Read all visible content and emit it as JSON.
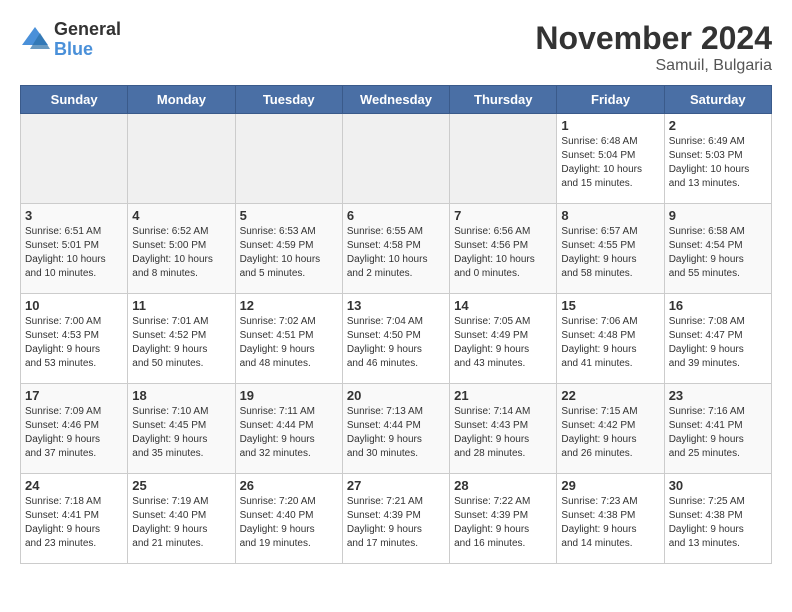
{
  "logo": {
    "general": "General",
    "blue": "Blue"
  },
  "header": {
    "title": "November 2024",
    "subtitle": "Samuil, Bulgaria"
  },
  "weekdays": [
    "Sunday",
    "Monday",
    "Tuesday",
    "Wednesday",
    "Thursday",
    "Friday",
    "Saturday"
  ],
  "weeks": [
    {
      "row_class": "week-row-1",
      "days": [
        {
          "num": "",
          "info": "",
          "empty": true
        },
        {
          "num": "",
          "info": "",
          "empty": true
        },
        {
          "num": "",
          "info": "",
          "empty": true
        },
        {
          "num": "",
          "info": "",
          "empty": true
        },
        {
          "num": "",
          "info": "",
          "empty": true
        },
        {
          "num": "1",
          "info": "Sunrise: 6:48 AM\nSunset: 5:04 PM\nDaylight: 10 hours\nand 15 minutes.",
          "empty": false
        },
        {
          "num": "2",
          "info": "Sunrise: 6:49 AM\nSunset: 5:03 PM\nDaylight: 10 hours\nand 13 minutes.",
          "empty": false
        }
      ]
    },
    {
      "row_class": "week-row-2",
      "days": [
        {
          "num": "3",
          "info": "Sunrise: 6:51 AM\nSunset: 5:01 PM\nDaylight: 10 hours\nand 10 minutes.",
          "empty": false
        },
        {
          "num": "4",
          "info": "Sunrise: 6:52 AM\nSunset: 5:00 PM\nDaylight: 10 hours\nand 8 minutes.",
          "empty": false
        },
        {
          "num": "5",
          "info": "Sunrise: 6:53 AM\nSunset: 4:59 PM\nDaylight: 10 hours\nand 5 minutes.",
          "empty": false
        },
        {
          "num": "6",
          "info": "Sunrise: 6:55 AM\nSunset: 4:58 PM\nDaylight: 10 hours\nand 2 minutes.",
          "empty": false
        },
        {
          "num": "7",
          "info": "Sunrise: 6:56 AM\nSunset: 4:56 PM\nDaylight: 10 hours\nand 0 minutes.",
          "empty": false
        },
        {
          "num": "8",
          "info": "Sunrise: 6:57 AM\nSunset: 4:55 PM\nDaylight: 9 hours\nand 58 minutes.",
          "empty": false
        },
        {
          "num": "9",
          "info": "Sunrise: 6:58 AM\nSunset: 4:54 PM\nDaylight: 9 hours\nand 55 minutes.",
          "empty": false
        }
      ]
    },
    {
      "row_class": "week-row-3",
      "days": [
        {
          "num": "10",
          "info": "Sunrise: 7:00 AM\nSunset: 4:53 PM\nDaylight: 9 hours\nand 53 minutes.",
          "empty": false
        },
        {
          "num": "11",
          "info": "Sunrise: 7:01 AM\nSunset: 4:52 PM\nDaylight: 9 hours\nand 50 minutes.",
          "empty": false
        },
        {
          "num": "12",
          "info": "Sunrise: 7:02 AM\nSunset: 4:51 PM\nDaylight: 9 hours\nand 48 minutes.",
          "empty": false
        },
        {
          "num": "13",
          "info": "Sunrise: 7:04 AM\nSunset: 4:50 PM\nDaylight: 9 hours\nand 46 minutes.",
          "empty": false
        },
        {
          "num": "14",
          "info": "Sunrise: 7:05 AM\nSunset: 4:49 PM\nDaylight: 9 hours\nand 43 minutes.",
          "empty": false
        },
        {
          "num": "15",
          "info": "Sunrise: 7:06 AM\nSunset: 4:48 PM\nDaylight: 9 hours\nand 41 minutes.",
          "empty": false
        },
        {
          "num": "16",
          "info": "Sunrise: 7:08 AM\nSunset: 4:47 PM\nDaylight: 9 hours\nand 39 minutes.",
          "empty": false
        }
      ]
    },
    {
      "row_class": "week-row-4",
      "days": [
        {
          "num": "17",
          "info": "Sunrise: 7:09 AM\nSunset: 4:46 PM\nDaylight: 9 hours\nand 37 minutes.",
          "empty": false
        },
        {
          "num": "18",
          "info": "Sunrise: 7:10 AM\nSunset: 4:45 PM\nDaylight: 9 hours\nand 35 minutes.",
          "empty": false
        },
        {
          "num": "19",
          "info": "Sunrise: 7:11 AM\nSunset: 4:44 PM\nDaylight: 9 hours\nand 32 minutes.",
          "empty": false
        },
        {
          "num": "20",
          "info": "Sunrise: 7:13 AM\nSunset: 4:44 PM\nDaylight: 9 hours\nand 30 minutes.",
          "empty": false
        },
        {
          "num": "21",
          "info": "Sunrise: 7:14 AM\nSunset: 4:43 PM\nDaylight: 9 hours\nand 28 minutes.",
          "empty": false
        },
        {
          "num": "22",
          "info": "Sunrise: 7:15 AM\nSunset: 4:42 PM\nDaylight: 9 hours\nand 26 minutes.",
          "empty": false
        },
        {
          "num": "23",
          "info": "Sunrise: 7:16 AM\nSunset: 4:41 PM\nDaylight: 9 hours\nand 25 minutes.",
          "empty": false
        }
      ]
    },
    {
      "row_class": "week-row-5",
      "days": [
        {
          "num": "24",
          "info": "Sunrise: 7:18 AM\nSunset: 4:41 PM\nDaylight: 9 hours\nand 23 minutes.",
          "empty": false
        },
        {
          "num": "25",
          "info": "Sunrise: 7:19 AM\nSunset: 4:40 PM\nDaylight: 9 hours\nand 21 minutes.",
          "empty": false
        },
        {
          "num": "26",
          "info": "Sunrise: 7:20 AM\nSunset: 4:40 PM\nDaylight: 9 hours\nand 19 minutes.",
          "empty": false
        },
        {
          "num": "27",
          "info": "Sunrise: 7:21 AM\nSunset: 4:39 PM\nDaylight: 9 hours\nand 17 minutes.",
          "empty": false
        },
        {
          "num": "28",
          "info": "Sunrise: 7:22 AM\nSunset: 4:39 PM\nDaylight: 9 hours\nand 16 minutes.",
          "empty": false
        },
        {
          "num": "29",
          "info": "Sunrise: 7:23 AM\nSunset: 4:38 PM\nDaylight: 9 hours\nand 14 minutes.",
          "empty": false
        },
        {
          "num": "30",
          "info": "Sunrise: 7:25 AM\nSunset: 4:38 PM\nDaylight: 9 hours\nand 13 minutes.",
          "empty": false
        }
      ]
    }
  ]
}
